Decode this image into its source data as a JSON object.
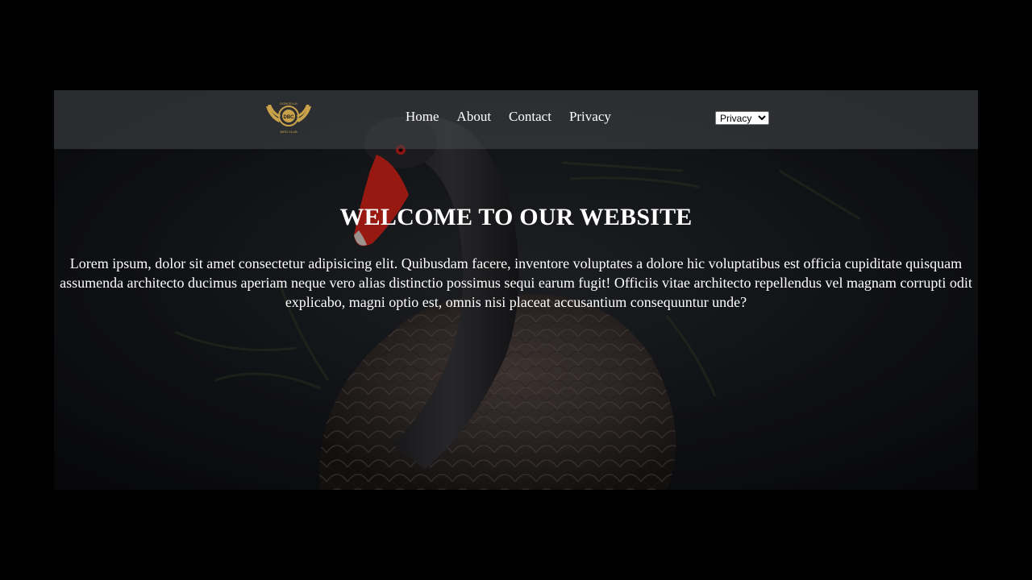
{
  "logo": {
    "text_top": "DONCELLA",
    "monogram": "DBC",
    "text_bottom": "BIRD CLUB",
    "color": "#c9a24a"
  },
  "nav": {
    "links": [
      "Home",
      "About",
      "Contact",
      "Privacy"
    ],
    "select_value": "Privacy"
  },
  "hero": {
    "title": "WELCOME TO OUR WEBSITE",
    "body": "Lorem ipsum, dolor sit amet consectetur adipisicing elit. Quibusdam facere, inventore voluptates a dolore hic voluptatibus est officia cupiditate quisquam assumenda architecto ducimus aperiam neque vero alias distinctio possimus sequi earum fugit! Officiis vitae architecto repellendus vel magnam corrupti odit explicabo, magni optio est, omnis nisi placeat accusantium consequuntur unde?",
    "image_subject": "black-swan"
  },
  "colors": {
    "page_background": "#000000",
    "beak": "#e0261b",
    "text": "#ffffff"
  }
}
